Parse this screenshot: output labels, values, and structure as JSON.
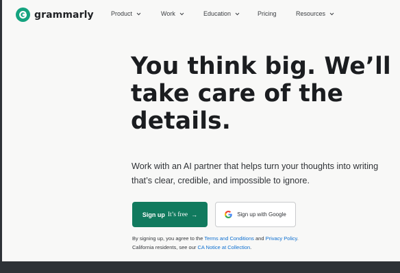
{
  "brand": {
    "name": "grammarly",
    "accent": "#14a37f",
    "button_color": "#117a5e",
    "link_color": "#0d6fd0"
  },
  "nav": {
    "items": [
      {
        "label": "Product",
        "has_dropdown": true
      },
      {
        "label": "Work",
        "has_dropdown": true
      },
      {
        "label": "Education",
        "has_dropdown": true
      },
      {
        "label": "Pricing",
        "has_dropdown": false
      },
      {
        "label": "Resources",
        "has_dropdown": true
      }
    ]
  },
  "hero": {
    "headline_lines": [
      "You think big. We’ll",
      "take care of the",
      "details."
    ],
    "subtext_lines": [
      "Work with an AI partner that helps turn your thoughts into writing",
      "that’s clear, credible, and impossible to ignore."
    ]
  },
  "cta": {
    "signup_label": "Sign up",
    "signup_suffix": "It’s free",
    "signup_arrow": "→",
    "google_label": "Sign up with Google"
  },
  "legal": {
    "line1_prefix": "By signing up, you agree to the ",
    "terms_link": "Terms and Conditions",
    "line1_mid": " and ",
    "privacy_link": "Privacy Policy",
    "line1_end": ".",
    "line2_prefix": "California residents, see our ",
    "ca_link": "CA Notice at Collection",
    "line2_end": "."
  }
}
